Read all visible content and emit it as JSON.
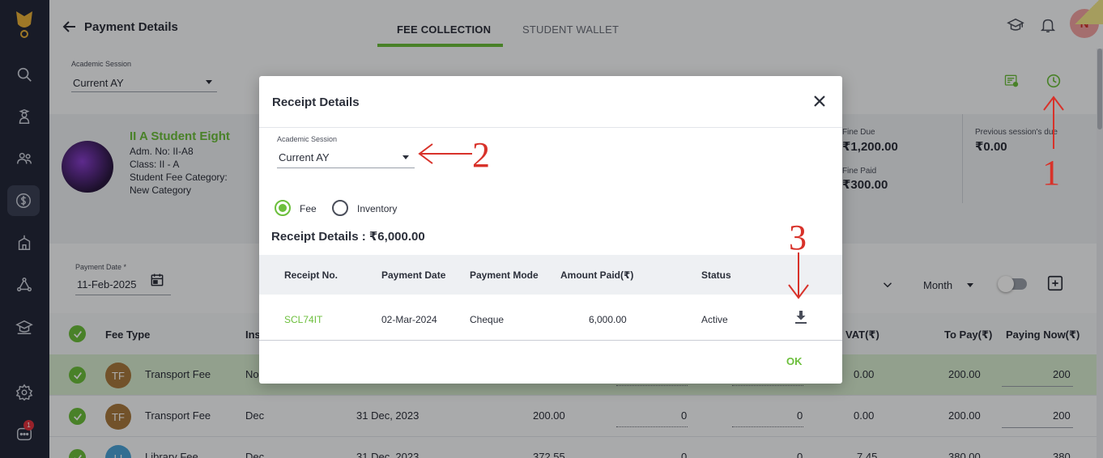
{
  "header": {
    "page_title": "Payment Details",
    "tabs": [
      {
        "label": "FEE COLLECTION",
        "active": true
      },
      {
        "label": "STUDENT WALLET",
        "active": false
      }
    ],
    "avatar_initial": "N"
  },
  "filters": {
    "academic_session_label": "Academic Session",
    "academic_session_value": "Current AY",
    "payment_date_label": "Payment Date *",
    "payment_date_value": "11-Feb-2025",
    "period_value": "Month"
  },
  "student": {
    "name": "II A Student Eight",
    "adm_no": "Adm. No: II-A8",
    "class": "Class: II - A",
    "fee_category_label": "Student Fee Category:",
    "fee_category_value": "New Category",
    "fine_due_label": "Fine Due",
    "fine_due_value": "₹1,200.00",
    "fine_paid_label": "Fine Paid",
    "fine_paid_value": "₹300.00",
    "prev_due_label": "Previous session's due",
    "prev_due_value": "₹0.00"
  },
  "fee_table": {
    "headers": {
      "fee_type": "Fee Type",
      "installment": "Ins",
      "vat": "VAT(₹)",
      "to_pay": "To Pay(₹)",
      "paying_now": "Paying Now(₹)"
    },
    "rows": [
      {
        "initials": "TF",
        "fee_type": "Transport Fee",
        "installment": "No",
        "date": "",
        "amount": "",
        "c1": "",
        "c2": "",
        "vat": "0.00",
        "to_pay": "200.00",
        "paying_now": "200"
      },
      {
        "initials": "TF",
        "fee_type": "Transport Fee",
        "installment": "Dec",
        "date": "31 Dec, 2023",
        "amount": "200.00",
        "c1": "0",
        "c2": "0",
        "vat": "0.00",
        "to_pay": "200.00",
        "paying_now": "200"
      },
      {
        "initials": "LI",
        "fee_type": "Library Fee",
        "installment": "Dec",
        "date": "31 Dec, 2023",
        "amount": "372.55",
        "c1": "0",
        "c2": "0",
        "vat": "7.45",
        "to_pay": "380.00",
        "paying_now": "380"
      }
    ]
  },
  "modal": {
    "title": "Receipt Details",
    "session_label": "Academic Session",
    "session_value": "Current AY",
    "radio_fee": "Fee",
    "radio_inventory": "Inventory",
    "total_label": "Receipt Details : ₹6,000.00",
    "columns": {
      "receipt_no": "Receipt No.",
      "payment_date": "Payment Date",
      "payment_mode": "Payment Mode",
      "amount_paid": "Amount Paid(₹)",
      "status": "Status"
    },
    "rows": [
      {
        "receipt_no": "SCL74IT",
        "payment_date": "02-Mar-2024",
        "payment_mode": "Cheque",
        "amount_paid": "6,000.00",
        "status": "Active"
      }
    ],
    "ok_label": "OK"
  },
  "annotations": {
    "one": "1",
    "two": "2",
    "three": "3"
  },
  "notification_count": "1",
  "colors": {
    "accent_green": "#6cbf3c",
    "sidebar_bg": "#24283a",
    "annotation_red": "#d8322a"
  }
}
